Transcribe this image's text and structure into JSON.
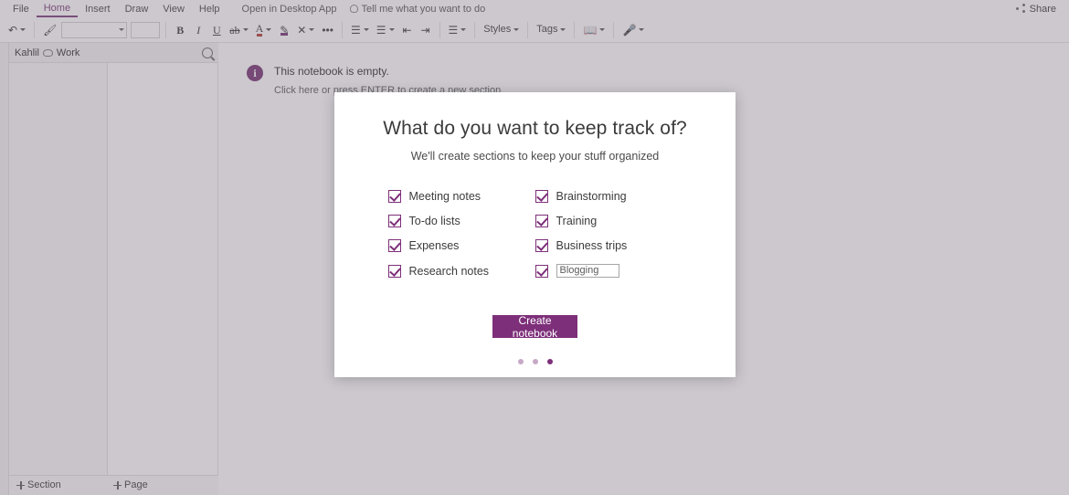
{
  "app": {
    "menu": [
      {
        "label": "File",
        "active": false
      },
      {
        "label": "Home",
        "active": true
      },
      {
        "label": "Insert",
        "active": false
      },
      {
        "label": "Draw",
        "active": false
      },
      {
        "label": "View",
        "active": false
      },
      {
        "label": "Help",
        "active": false
      }
    ],
    "open_desktop_app": "Open in Desktop App",
    "tell_me": "Tell me what you want to do",
    "share": "Share"
  },
  "ribbon": {
    "undo": "↶",
    "redo": "↷",
    "font_name": "",
    "font_size": "",
    "bold": "B",
    "italic": "I",
    "underline": "U",
    "strikethrough": "ab",
    "font_color": "A",
    "highlight": "✎",
    "clear_format": "✕",
    "more": "•••",
    "bullets": "☰",
    "numbering": "☰",
    "decrease_indent": "⇤",
    "increase_indent": "⇥",
    "align": "☰",
    "styles": "Styles",
    "tags": "Tags",
    "dictate": "🎤",
    "immersive": "📖"
  },
  "sidebar": {
    "notebook_name": "Kahlil",
    "notebook_status": "Work",
    "add_section": "Section",
    "add_page": "Page"
  },
  "canvas": {
    "empty_title": "This notebook is empty.",
    "empty_hint": "Click here or press ENTER to create a new section."
  },
  "modal": {
    "title": "What do you want to keep track of?",
    "subtitle": "We'll create sections to keep your stuff organized",
    "options": [
      {
        "label": "Meeting notes",
        "checked": true
      },
      {
        "label": "Brainstorming",
        "checked": true
      },
      {
        "label": "To-do lists",
        "checked": true
      },
      {
        "label": "Training",
        "checked": true
      },
      {
        "label": "Expenses",
        "checked": true
      },
      {
        "label": "Business trips",
        "checked": true
      },
      {
        "label": "Research notes",
        "checked": true
      }
    ],
    "custom_option": {
      "checked": true,
      "value": "Blogging",
      "placeholder": ""
    },
    "create_button": "Create notebook",
    "pager": {
      "total": 3,
      "active_index": 2
    }
  },
  "colors": {
    "accent": "#7d2f79",
    "scrim": "rgba(120,110,125,0.38)",
    "modal_bg": "#ffffff"
  }
}
